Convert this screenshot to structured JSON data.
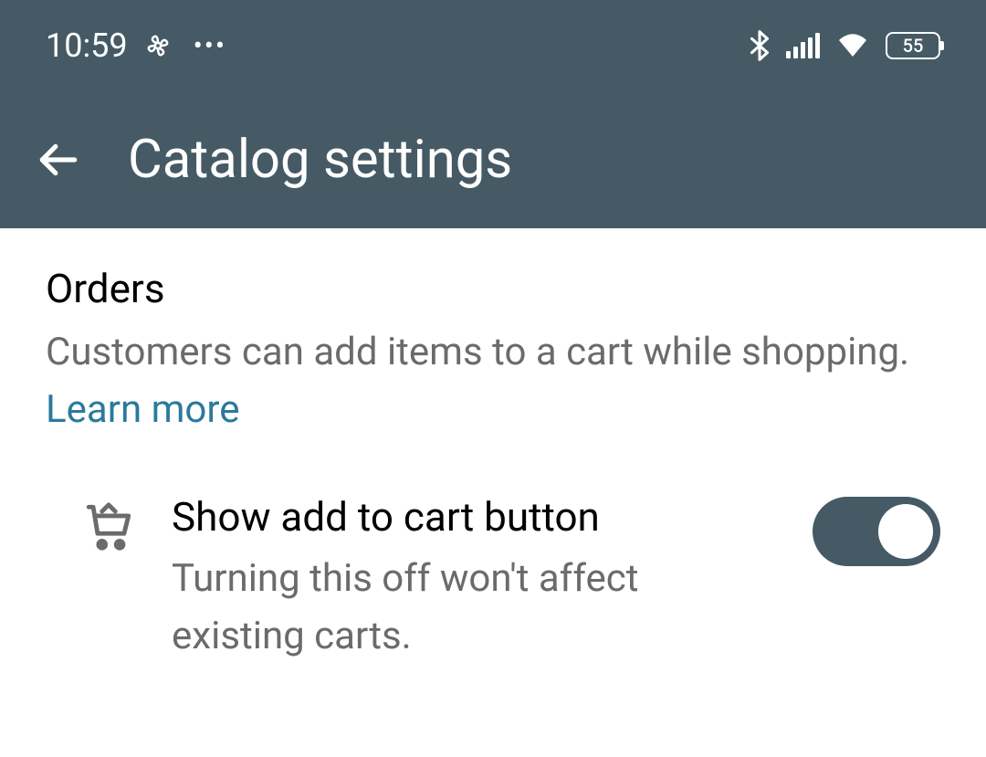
{
  "statusBar": {
    "time": "10:59",
    "batteryLevel": "55"
  },
  "appBar": {
    "title": "Catalog settings"
  },
  "section": {
    "title": "Orders",
    "description": "Customers can add items to a cart while shopping. ",
    "learnMore": "Learn more"
  },
  "setting": {
    "label": "Show add to cart button",
    "sub": "Turning this off won't affect existing carts.",
    "enabled": true
  }
}
